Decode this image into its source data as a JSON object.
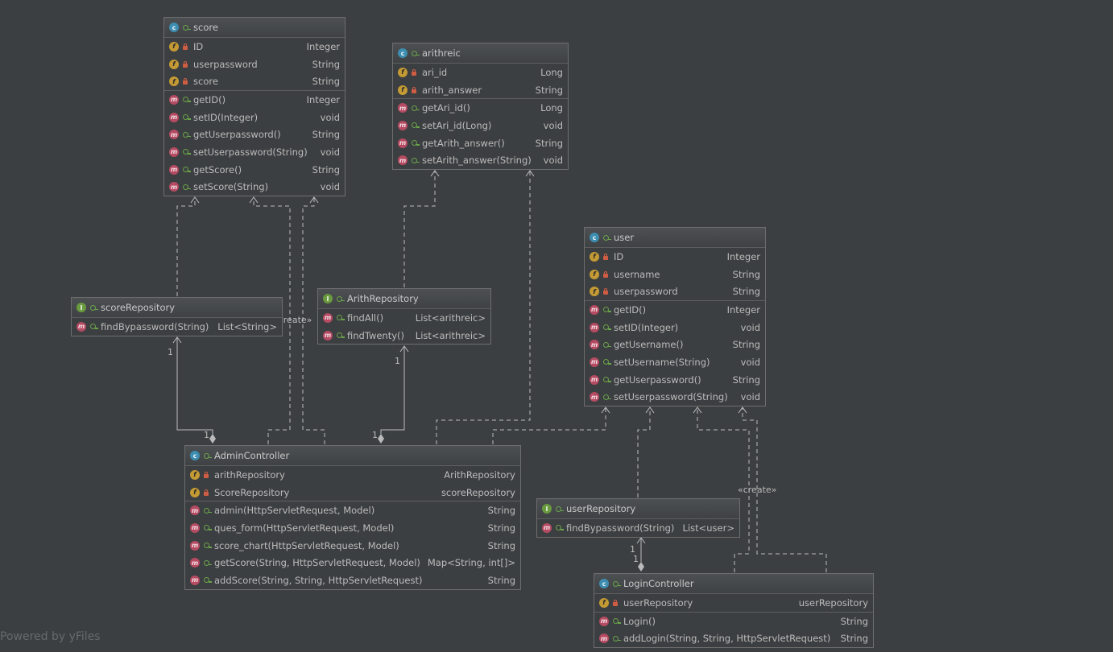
{
  "classes": {
    "score": {
      "name": "score",
      "fields": [
        {
          "name": "ID",
          "type": "Integer"
        },
        {
          "name": "userpassword",
          "type": "String"
        },
        {
          "name": "score",
          "type": "String"
        }
      ],
      "methods": [
        {
          "name": "getID()",
          "type": "Integer"
        },
        {
          "name": "setID(Integer)",
          "type": "void"
        },
        {
          "name": "getUserpassword()",
          "type": "String"
        },
        {
          "name": "setUserpassword(String)",
          "type": "void"
        },
        {
          "name": "getScore()",
          "type": "String"
        },
        {
          "name": "setScore(String)",
          "type": "void"
        }
      ]
    },
    "arithreic": {
      "name": "arithreic",
      "fields": [
        {
          "name": "ari_id",
          "type": "Long"
        },
        {
          "name": "arith_answer",
          "type": "String"
        }
      ],
      "methods": [
        {
          "name": "getAri_id()",
          "type": "Long"
        },
        {
          "name": "setAri_id(Long)",
          "type": "void"
        },
        {
          "name": "getArith_answer()",
          "type": "String"
        },
        {
          "name": "setArith_answer(String)",
          "type": "void"
        }
      ]
    },
    "user": {
      "name": "user",
      "fields": [
        {
          "name": "ID",
          "type": "Integer"
        },
        {
          "name": "username",
          "type": "String"
        },
        {
          "name": "userpassword",
          "type": "String"
        }
      ],
      "methods": [
        {
          "name": "getID()",
          "type": "Integer"
        },
        {
          "name": "setID(Integer)",
          "type": "void"
        },
        {
          "name": "getUsername()",
          "type": "String"
        },
        {
          "name": "setUsername(String)",
          "type": "void"
        },
        {
          "name": "getUserpassword()",
          "type": "String"
        },
        {
          "name": "setUserpassword(String)",
          "type": "void"
        }
      ]
    },
    "scoreRepository": {
      "name": "scoreRepository",
      "methods": [
        {
          "name": "findBypassword(String)",
          "type": "List<String>"
        }
      ]
    },
    "arithRepository": {
      "name": "ArithRepository",
      "methods": [
        {
          "name": "findAll()",
          "type": "List<arithreic>"
        },
        {
          "name": "findTwenty()",
          "type": "List<arithreic>"
        }
      ]
    },
    "userRepository": {
      "name": "userRepository",
      "methods": [
        {
          "name": "findBypassword(String)",
          "type": "List<user>"
        }
      ]
    },
    "adminController": {
      "name": "AdminController",
      "fields": [
        {
          "name": "arithRepository",
          "type": "ArithRepository"
        },
        {
          "name": "ScoreRepository",
          "type": "scoreRepository"
        }
      ],
      "methods": [
        {
          "name": "admin(HttpServletRequest, Model)",
          "type": "String"
        },
        {
          "name": "ques_form(HttpServletRequest, Model)",
          "type": "String"
        },
        {
          "name": "score_chart(HttpServletRequest, Model)",
          "type": "String"
        },
        {
          "name": "getScore(String, HttpServletRequest, Model)",
          "type": "Map<String, int[]>"
        },
        {
          "name": "addScore(String, String, HttpServletRequest)",
          "type": "String"
        }
      ]
    },
    "loginController": {
      "name": "LoginController",
      "fields": [
        {
          "name": "userRepository",
          "type": "userRepository"
        }
      ],
      "methods": [
        {
          "name": "Login()",
          "type": "String"
        },
        {
          "name": "addLogin(String, String, HttpServletRequest)",
          "type": "String"
        }
      ]
    }
  },
  "labels": {
    "create1": "«create»",
    "create2": "«create»",
    "mult_score_top": "1",
    "mult_score_bottom": "1",
    "mult_arith_top": "1",
    "mult_arith_bottom": "1",
    "mult_user_top": "1",
    "mult_user_bottom": "1"
  },
  "icons": {
    "class": "class-icon",
    "interface": "interface-icon",
    "field": "field-icon",
    "method": "method-icon"
  },
  "colors": {
    "background": "#3c3f41",
    "class_icon": "#3d8db0",
    "interface_icon": "#6a9a3f",
    "field_icon": "#c49a34",
    "method_icon": "#b54b62"
  },
  "watermark": "Powered by yFiles"
}
